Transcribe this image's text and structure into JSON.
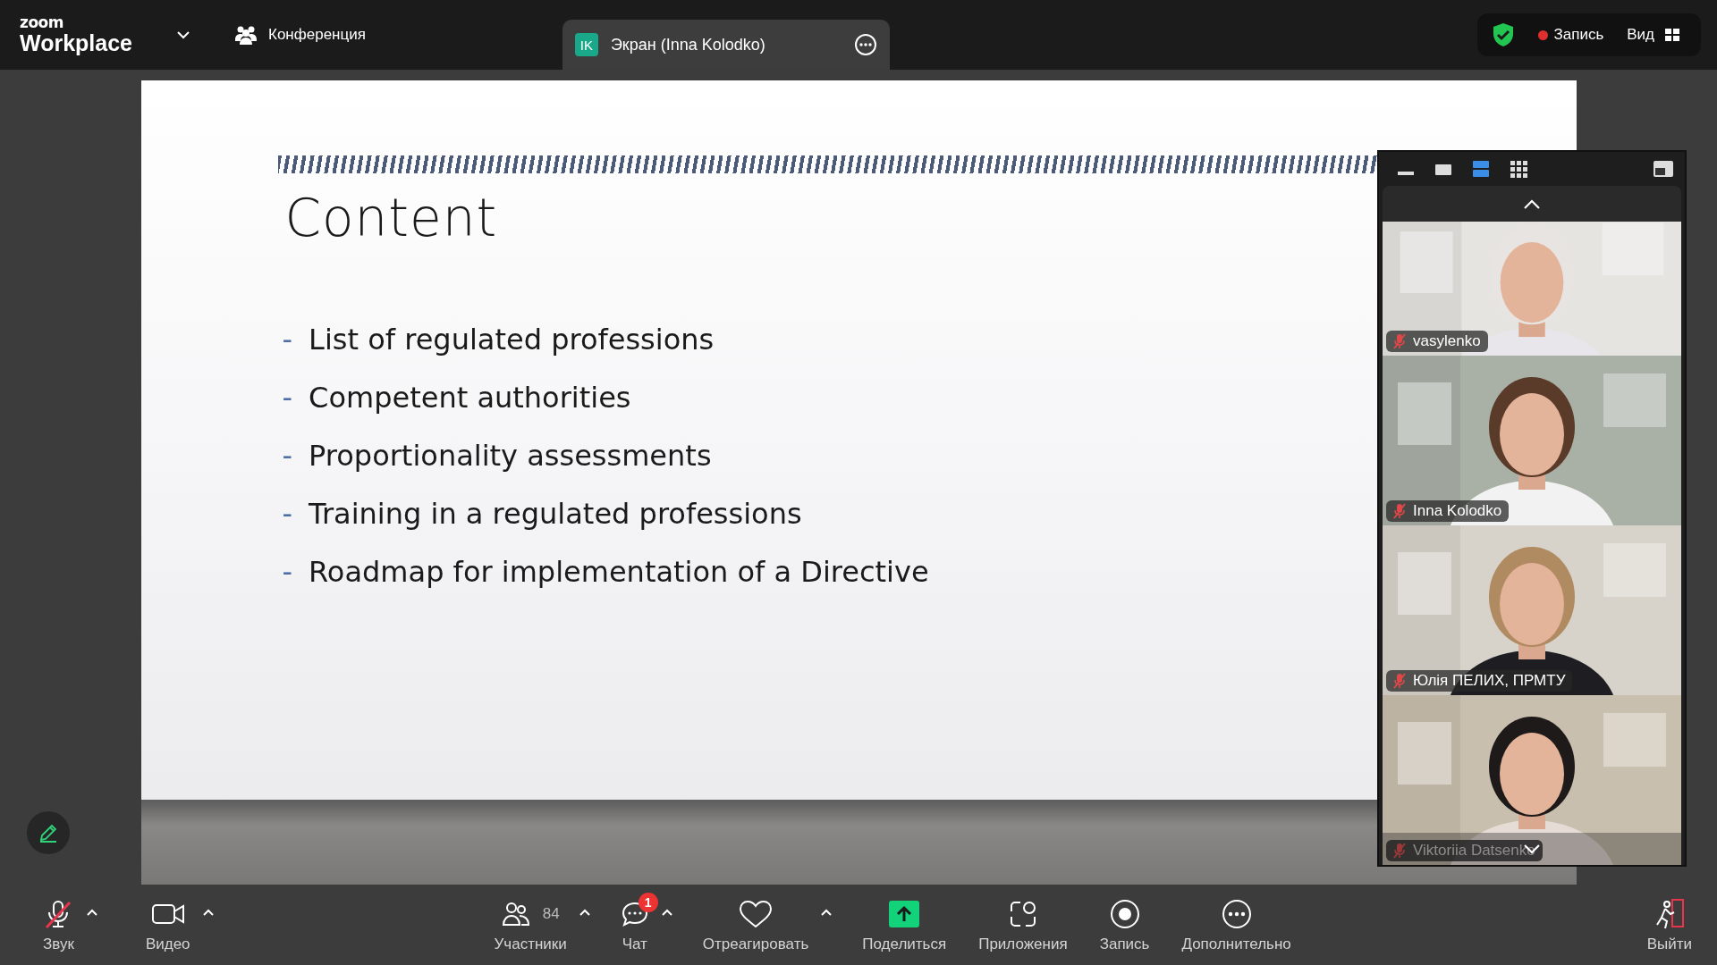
{
  "top_bar": {
    "logo_small": "zoom",
    "logo_large": "Workplace",
    "meeting_tab": "Конференция",
    "share_tab": {
      "initials": "IK",
      "label": "Экран (Inna Kolodko)",
      "selected": true
    },
    "recording": {
      "label": "Запись",
      "on": true
    },
    "view": "Вид"
  },
  "slide": {
    "title": "Content",
    "items": [
      {
        "dash": "-",
        "text": "List of regulated professions"
      },
      {
        "dash": "-",
        "text": "Competent authorities"
      },
      {
        "dash": "-",
        "text": "Proportionality assessments"
      },
      {
        "dash": "-",
        "text": "Training in a regulated professions"
      },
      {
        "dash": "-",
        "text": "Roadmap for implementation of a Directive"
      }
    ]
  },
  "video_panel": {
    "layouts": [
      {
        "kind": "minimize",
        "selected": false
      },
      {
        "kind": "single",
        "selected": false
      },
      {
        "kind": "stack",
        "selected": true
      },
      {
        "kind": "grid",
        "selected": false
      }
    ],
    "tiles": [
      {
        "name": "vasylenko",
        "muted": true
      },
      {
        "name": "Inna Kolodko",
        "muted": true
      },
      {
        "name": "Юлія ПЕЛИХ, ПРМТУ",
        "muted": true
      },
      {
        "name": "Viktoriia Datsenko",
        "muted": true
      }
    ]
  },
  "toolbar": [
    {
      "kind": "audio",
      "label": "Звук",
      "muted": true,
      "caret": true
    },
    {
      "kind": "video",
      "label": "Видео",
      "caret": true
    },
    {
      "kind": "participants",
      "label": "Участники",
      "count": "84",
      "caret": true
    },
    {
      "kind": "chat",
      "label": "Чат",
      "badge": "1",
      "caret": true
    },
    {
      "kind": "react",
      "label": "Отреагировать",
      "caret": true
    },
    {
      "kind": "share",
      "label": "Поделиться",
      "caret": false
    },
    {
      "kind": "apps",
      "label": "Приложения",
      "caret": false
    },
    {
      "kind": "record",
      "label": "Запись",
      "caret": false
    },
    {
      "kind": "more",
      "label": "Дополнительно",
      "caret": false
    },
    {
      "kind": "leave",
      "label": "Выйти",
      "caret": false
    }
  ]
}
